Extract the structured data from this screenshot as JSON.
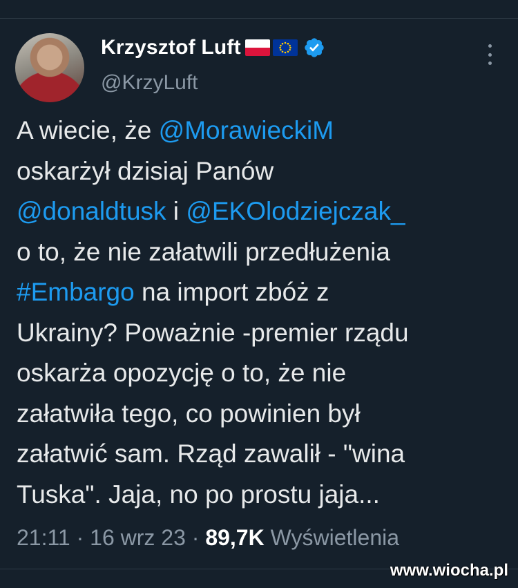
{
  "author": {
    "display_name": "Krzysztof Luft",
    "handle": "@KrzyLuft",
    "flags": [
      "flag-poland-icon",
      "flag-eu-icon"
    ],
    "verified": true
  },
  "tweet": {
    "lines": [
      [
        {
          "t": "A wiecie, że "
        },
        {
          "t": "@MorawieckiM",
          "link": true
        }
      ],
      [
        {
          "t": "oskarżył dzisiaj Panów"
        }
      ],
      [
        {
          "t": "@donaldtusk",
          "link": true
        },
        {
          "t": " i "
        },
        {
          "t": "@EKOlodziejczak_",
          "link": true
        }
      ],
      [
        {
          "t": "o to, że nie załatwili przedłużenia"
        }
      ],
      [
        {
          "t": "#Embargo",
          "link": true
        },
        {
          "t": " na import zbóż z"
        }
      ],
      [
        {
          "t": "Ukrainy? Poważnie -premier rządu"
        }
      ],
      [
        {
          "t": "oskarża opozycję o to, że nie"
        }
      ],
      [
        {
          "t": "załatwiła tego, co powinien był"
        }
      ],
      [
        {
          "t": "załatwić sam. Rząd zawalił - \"wina"
        }
      ],
      [
        {
          "t": "Tuska\". Jaja, no po prostu jaja..."
        }
      ]
    ]
  },
  "meta": {
    "time": "21:11",
    "date": "16 wrz 23",
    "separator": " · ",
    "views_count": "89,7K",
    "views_label": "Wyświetlenia"
  },
  "watermark": "www.wiocha.pl",
  "colors": {
    "background": "#15202b",
    "link": "#1d9bf0",
    "secondary_text": "#8b98a5"
  }
}
